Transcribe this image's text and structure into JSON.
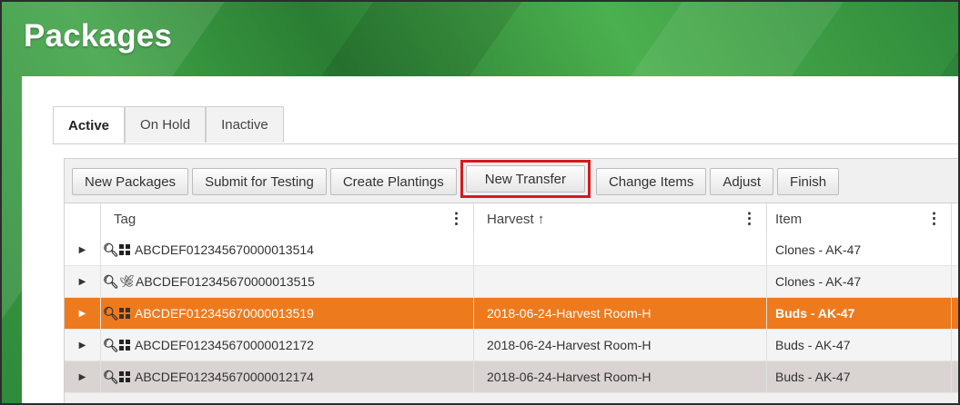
{
  "page": {
    "title": "Packages"
  },
  "tabs": [
    {
      "label": "Active",
      "active": true
    },
    {
      "label": "On Hold",
      "active": false
    },
    {
      "label": "Inactive",
      "active": false
    }
  ],
  "toolbar": {
    "new_packages": "New Packages",
    "submit_for_testing": "Submit for Testing",
    "create_plantings": "Create Plantings",
    "new_transfer": "New Transfer",
    "change_items": "Change Items",
    "adjust": "Adjust",
    "finish": "Finish"
  },
  "columns": {
    "tag": "Tag",
    "harvest": "Harvest ↑",
    "item": "Item",
    "menu_glyph": "⋮"
  },
  "rows": [
    {
      "tag": "ABCDEF012345670000013514",
      "icon": "grid-icon",
      "harvest": "",
      "item": "Clones - AK-47"
    },
    {
      "tag": "ABCDEF012345670000013515",
      "icon": "leaf-icon",
      "harvest": "",
      "item": "Clones - AK-47"
    },
    {
      "tag": "ABCDEF012345670000013519",
      "icon": "grid-icon",
      "harvest": "2018-06-24-Harvest Room-H",
      "item": "Buds - AK-47"
    },
    {
      "tag": "ABCDEF012345670000012172",
      "icon": "grid-icon",
      "harvest": "2018-06-24-Harvest Room-H",
      "item": "Buds - AK-47"
    },
    {
      "tag": "ABCDEF012345670000012174",
      "icon": "grid-icon",
      "harvest": "2018-06-24-Harvest Room-H",
      "item": "Buds - AK-47"
    }
  ],
  "colors": {
    "selected_row": "#ee7a1e",
    "highlight_box": "#d41b1b",
    "banner_green": "#3ea345"
  }
}
